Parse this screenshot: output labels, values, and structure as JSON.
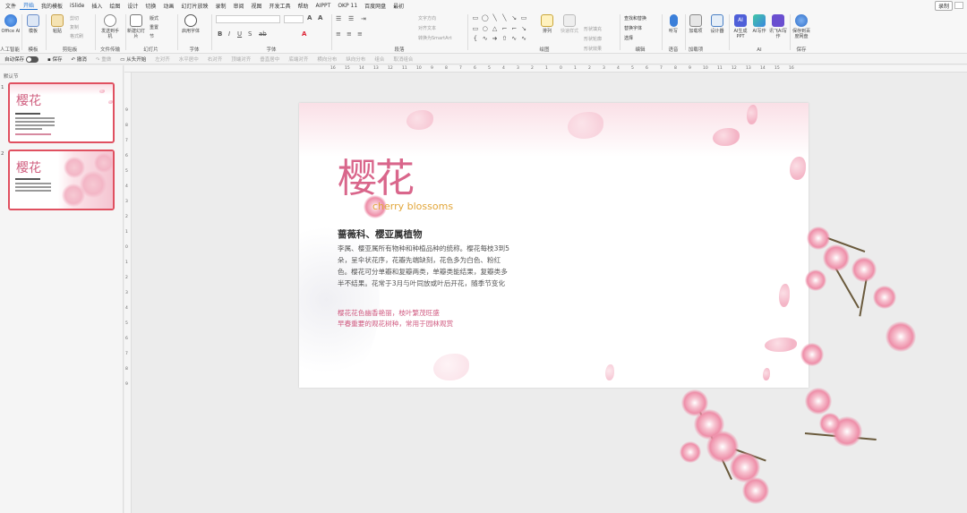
{
  "menu": {
    "items": [
      "文件",
      "开始",
      "我的模板",
      "iSlide",
      "插入",
      "绘图",
      "设计",
      "切换",
      "动画",
      "幻灯片放映",
      "录制",
      "审阅",
      "视图",
      "开发工具",
      "帮助",
      "AIPPT",
      "OKP 11",
      "百度网盘",
      "最初"
    ],
    "active": "开始",
    "record_label": "录制"
  },
  "ribbon": {
    "groups": {
      "ai": "人工智能",
      "template": "模板",
      "clipboard": "剪贴板",
      "file_transfer": "文件传输",
      "slides": "幻灯片",
      "font_group": "字体",
      "font": "字体",
      "paragraph": "段落",
      "drawing": "绘图",
      "edit": "编辑",
      "voice": "语音",
      "addins": "加载项",
      "ai2": "AI",
      "save": "保存"
    },
    "buttons": {
      "office_ai": "Office AI",
      "template": "模板",
      "paste": "粘贴",
      "cut": "剪切",
      "copy": "复制",
      "format_painter": "格式刷",
      "send_to_phone": "发送到手机",
      "new_slide": "新建幻灯片",
      "layout": "版式",
      "reset": "重置",
      "section": "节",
      "use_font": "启用字体",
      "arrange": "排列",
      "quick_style": "快速样式",
      "find_replace": "查找和替换",
      "replace_font": "替换字体",
      "select": "选择",
      "dictate": "听写",
      "addins": "加载项",
      "designer": "设计器",
      "ai_ppt": "AI生成PPT",
      "ai_write": "AI写作",
      "xfyun": "讯飞AI写作",
      "save_baidu": "保存到百度网盘"
    },
    "disabled_texts": {
      "text_direction": "文字方向",
      "align_text": "对齐文本",
      "smartart": "转换为SmartArt",
      "shape_fill": "形状填充",
      "shape_outline": "形状轮廓",
      "shape_effect": "形状效果"
    }
  },
  "qat": {
    "autosave": "自动保存",
    "save": "保存",
    "undo": "撤消",
    "redo": "重做",
    "from_start": "从头开始",
    "align_left": "左对齐",
    "center": "水平居中",
    "align_right": "右对齐",
    "top_align": "顶端对齐",
    "middle_align": "垂直居中",
    "bottom_align": "底端对齐",
    "distribute_h": "横向分布",
    "distribute_v": "纵向分布",
    "group": "组合",
    "ungroup": "取消组合"
  },
  "panel": {
    "section": "默认节",
    "slide_numbers": [
      "1",
      "2"
    ]
  },
  "ruler": {
    "h": [
      "16",
      "15",
      "14",
      "13",
      "12",
      "11",
      "10",
      "9",
      "8",
      "7",
      "6",
      "5",
      "4",
      "3",
      "2",
      "1",
      "0",
      "1",
      "2",
      "3",
      "4",
      "5",
      "6",
      "7",
      "8",
      "9",
      "10",
      "11",
      "12",
      "13",
      "14",
      "15",
      "16"
    ],
    "v": [
      "9",
      "8",
      "7",
      "6",
      "5",
      "4",
      "3",
      "2",
      "1",
      "0",
      "1",
      "2",
      "3",
      "4",
      "5",
      "6",
      "7",
      "8",
      "9"
    ]
  },
  "slide": {
    "title": "樱花",
    "subtitle": "cherry blossoms",
    "heading": "蔷薇科、樱亚属植物",
    "body": "李属、樱亚属所有物种和种植品种的统称。樱花每枝3到5朵，呈伞状花序，花瓣先端缺刻，花色多为白色、粉红色。樱花可分单瓣和复瓣两类，单瓣类能结果，复瓣类多半不结果。花常于3月与叶同放或叶后开花，随季节变化",
    "quote_line1": "樱花花色幽香艳丽，枝叶繁茂旺盛",
    "quote_line2": "早春重要的观花树种，常用于园林观赏"
  },
  "thumb": {
    "title": "樱花"
  },
  "colors": {
    "accent": "#1d6fd0",
    "title_pink": "#d9668b",
    "subtitle_gold": "#e2a63a",
    "quote_pink": "#d05a80",
    "thumb_border": "#e05060"
  }
}
